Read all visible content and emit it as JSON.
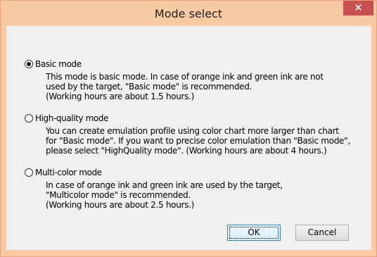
{
  "window": {
    "title": "Mode select",
    "close_glyph": "✕"
  },
  "options": [
    {
      "label": "Basic mode",
      "checked": true,
      "description": [
        "This mode is basic mode. In case of orange ink and green ink are not",
        "used by the target, \"Basic mode\" is recommended.",
        "(Working hours are about 1.5 hours.)"
      ]
    },
    {
      "label": "High-quality mode",
      "checked": false,
      "description": [
        "You can create emulation profile using color chart more larger than chart",
        "for \"Basic mode\". If you want to precise color emulation than \"Basic mode\",",
        "please select \"HighQuality mode\". (Working hours are about 4 hours.)"
      ]
    },
    {
      "label": "Multi-color mode",
      "checked": false,
      "description": [
        "In case of orange ink and green ink are used by the target,",
        "\"Multicolor mode\" is recommended.",
        "(Working hours are about 2.5 hours.)"
      ]
    }
  ],
  "buttons": {
    "ok": "OK",
    "cancel": "Cancel"
  },
  "colors": {
    "title_bar": "#f9c9a4",
    "close_button": "#c75050",
    "client_bg": "#f0f0f0"
  }
}
